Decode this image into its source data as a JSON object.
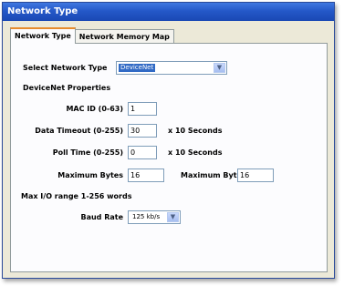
{
  "window": {
    "title": "Network Type"
  },
  "tabs": [
    {
      "label": "Network Type",
      "active": true
    },
    {
      "label": "Network Memory Map",
      "active": false
    }
  ],
  "form": {
    "select_network_type_label": "Select Network Type",
    "select_network_type_value": "DeviceNet",
    "properties_heading": "DeviceNet Properties",
    "mac_id_label": "MAC ID (0-63)",
    "mac_id_value": "1",
    "data_timeout_label": "Data Timeout (0-255)",
    "data_timeout_value": "30",
    "data_timeout_unit": "x 10 Seconds",
    "poll_time_label": "Poll Time (0-255)",
    "poll_time_value": "0",
    "poll_time_unit": "x 10 Seconds",
    "maximum_bytes_label_1": "Maximum Bytes",
    "maximum_bytes_value_1": "16",
    "maximum_bytes_label_2": "Maximum Bytes",
    "maximum_bytes_value_2": "16",
    "max_io_note": "Max I/O range 1-256 words",
    "baud_rate_label": "Baud Rate",
    "baud_rate_value": "125 kb/s"
  },
  "colors": {
    "titlebar": "#2458c8",
    "selection": "#316ac5",
    "active_tab_accent": "#e68b2c"
  }
}
